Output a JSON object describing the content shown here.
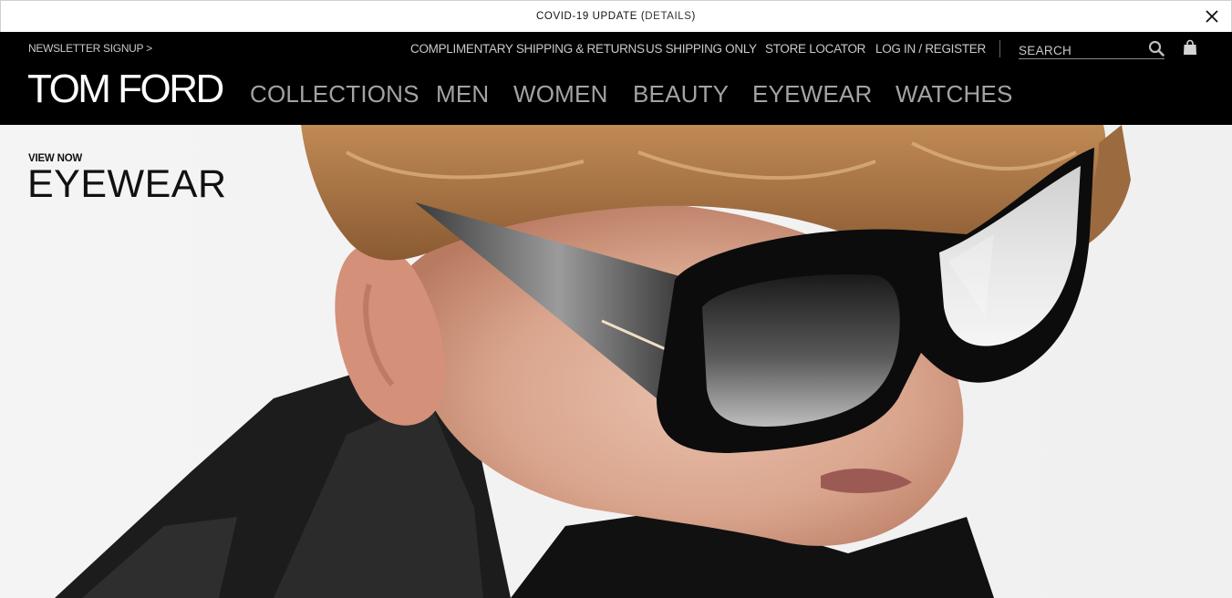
{
  "announcement": {
    "text": "COVID-19 UPDATE (",
    "link": "DETAILS",
    "suffix": ")"
  },
  "header": {
    "newsletter": "NEWSLETTER SIGNUP >",
    "utility_links": [
      "COMPLIMENTARY SHIPPING & RETURNS",
      "US SHIPPING ONLY",
      "STORE LOCATOR",
      "LOG IN / REGISTER"
    ],
    "search_placeholder": "SEARCH",
    "logo": "TOM FORD",
    "nav": [
      "COLLECTIONS",
      "MEN",
      "WOMEN",
      "BEAUTY",
      "EYEWEAR",
      "WATCHES"
    ]
  },
  "hero": {
    "kicker": "VIEW NOW",
    "title": "EYEWEAR"
  },
  "colors": {
    "header_bg": "#000000",
    "nav_text": "#a3a3a3",
    "utility_text": "#c9c9c9"
  }
}
